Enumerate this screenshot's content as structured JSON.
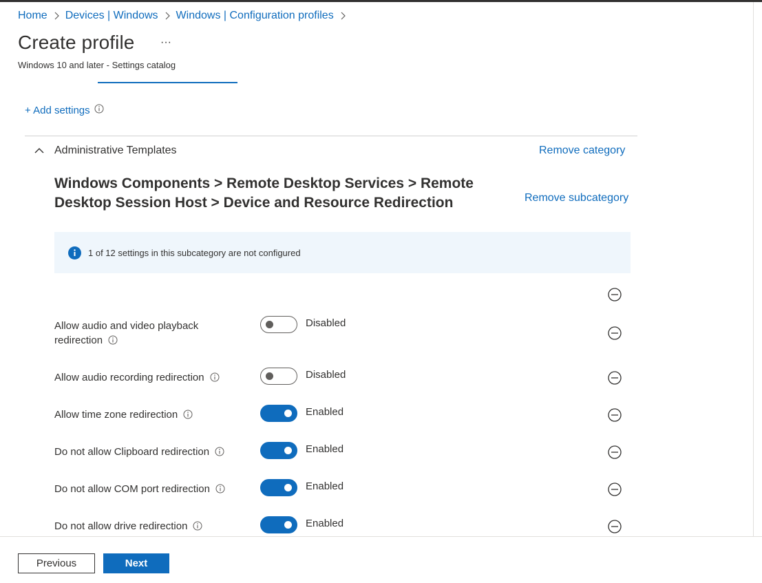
{
  "breadcrumb": {
    "items": [
      "Home",
      "Devices | Windows",
      "Windows | Configuration profiles"
    ]
  },
  "header": {
    "title": "Create profile",
    "more_label": "···",
    "subtitle": "Windows 10 and later - Settings catalog"
  },
  "settings_panel": {
    "add_settings_label": "+ Add settings",
    "category": {
      "name": "Administrative Templates",
      "remove_label": "Remove category",
      "subcategory": {
        "path": "Windows Components > Remote Desktop Services > Remote Desktop Session Host > Device and Resource Redirection",
        "remove_label": "Remove subcategory",
        "info_banner": "1 of 12 settings in this subcategory are not configured",
        "settings": [
          {
            "label": "Allow audio and video playback redirection",
            "enabled": false,
            "state": "Disabled"
          },
          {
            "label": "Allow audio recording redirection",
            "enabled": false,
            "state": "Disabled"
          },
          {
            "label": "Allow time zone redirection",
            "enabled": true,
            "state": "Enabled"
          },
          {
            "label": "Do not allow Clipboard redirection",
            "enabled": true,
            "state": "Enabled"
          },
          {
            "label": "Do not allow COM port redirection",
            "enabled": true,
            "state": "Enabled"
          },
          {
            "label": "Do not allow drive redirection",
            "enabled": true,
            "state": "Enabled"
          }
        ]
      }
    }
  },
  "footer": {
    "previous_label": "Previous",
    "next_label": "Next"
  },
  "colors": {
    "accent": "#0f6cbd",
    "banner_background": "#eff6fc",
    "text": "#323130"
  }
}
